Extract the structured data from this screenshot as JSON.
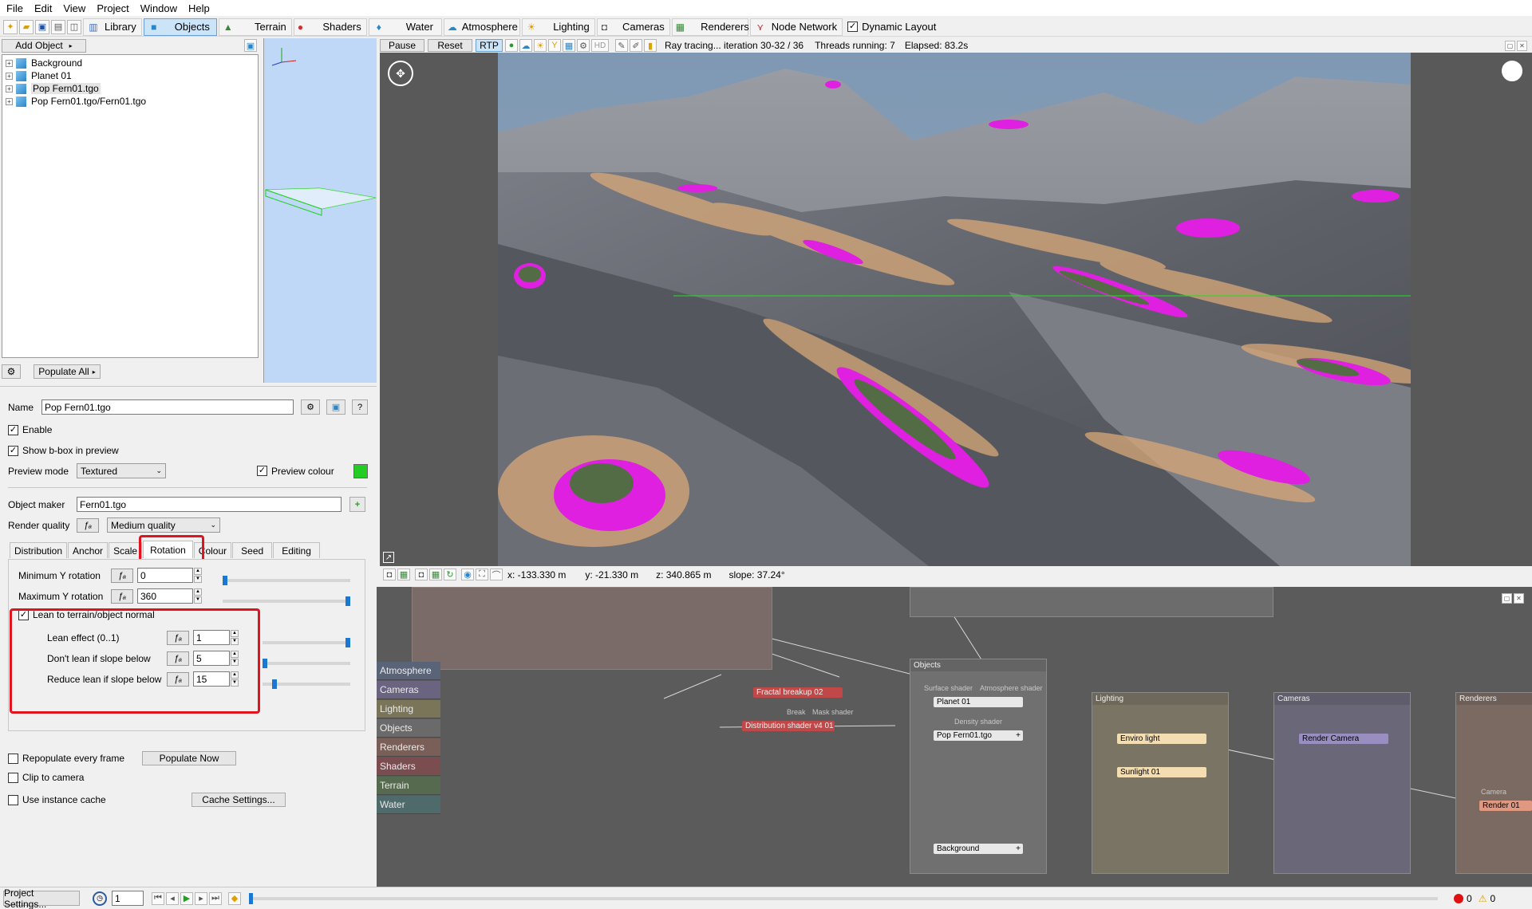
{
  "menu": [
    "File",
    "Edit",
    "View",
    "Project",
    "Window",
    "Help"
  ],
  "toolbar": {
    "tabs": [
      {
        "label": "Library",
        "icon": "library-icon"
      },
      {
        "label": "Objects",
        "icon": "cube-icon",
        "active": true
      },
      {
        "label": "Terrain",
        "icon": "terrain-icon"
      },
      {
        "label": "Shaders",
        "icon": "shader-sphere-icon"
      },
      {
        "label": "Water",
        "icon": "water-drop-icon"
      },
      {
        "label": "Atmosphere",
        "icon": "cloud-icon"
      },
      {
        "label": "Lighting",
        "icon": "sun-icon"
      },
      {
        "label": "Cameras",
        "icon": "camera-icon"
      },
      {
        "label": "Renderers",
        "icon": "render-icon"
      },
      {
        "label": "Node Network",
        "icon": "node-network-icon"
      }
    ],
    "dynamic_layout_label": "Dynamic Layout",
    "dynamic_layout_checked": true
  },
  "object_panel": {
    "add_object_label": "Add Object",
    "tree": [
      "Background",
      "Planet 01",
      "Pop Fern01.tgo",
      "Pop Fern01.tgo/Fern01.tgo"
    ],
    "populate_all_label": "Populate All"
  },
  "props": {
    "name_label": "Name",
    "name_value": "Pop Fern01.tgo",
    "enable_label": "Enable",
    "show_bbox_label": "Show b-box in preview",
    "preview_mode_label": "Preview mode",
    "preview_mode_value": "Textured",
    "preview_colour_label": "Preview colour",
    "preview_colour": "#22cc22",
    "object_maker_label": "Object maker",
    "object_maker_value": "Fern01.tgo",
    "render_quality_label": "Render quality",
    "render_quality_value": "Medium quality",
    "tabs": [
      "Distribution",
      "Anchor",
      "Scale",
      "Rotation",
      "Colour",
      "Seed",
      "Editing"
    ],
    "active_tab": "Rotation",
    "min_y_label": "Minimum Y rotation",
    "min_y_value": "0",
    "max_y_label": "Maximum Y rotation",
    "max_y_value": "360",
    "lean_label": "Lean to terrain/object normal",
    "lean_effect_label": "Lean effect (0..1)",
    "lean_effect_value": "1",
    "dont_lean_label": "Don't lean if slope below",
    "dont_lean_value": "5",
    "reduce_lean_label": "Reduce lean if slope below",
    "reduce_lean_value": "15",
    "repopulate_label": "Repopulate every frame",
    "populate_now_label": "Populate Now",
    "clip_label": "Clip to camera",
    "instance_cache_label": "Use instance cache",
    "cache_settings_label": "Cache Settings...",
    "accent_red": "#e0141e"
  },
  "render_toolbar": {
    "pause_label": "Pause",
    "reset_label": "Reset",
    "rtp_label": "RTP",
    "hd_label": "HD",
    "status": "Ray tracing... iteration 30-32 / 36",
    "threads": "Threads running: 7",
    "elapsed": "Elapsed: 83.2s"
  },
  "view_status": {
    "x": "x: -133.330 m",
    "y": "y: -21.330 m",
    "z": "z: 340.865 m",
    "slope": "slope: 37.24°"
  },
  "node_network": {
    "categories": [
      {
        "label": "Atmosphere",
        "color": "#5a6478"
      },
      {
        "label": "Cameras",
        "color": "#6a6480"
      },
      {
        "label": "Lighting",
        "color": "#7a7458"
      },
      {
        "label": "Objects",
        "color": "#6a6a6a"
      },
      {
        "label": "Renderers",
        "color": "#7a5e58"
      },
      {
        "label": "Shaders",
        "color": "#7a4e50"
      },
      {
        "label": "Terrain",
        "color": "#556a4e"
      },
      {
        "label": "Water",
        "color": "#4e6a6a"
      }
    ],
    "groups": {
      "objects_title": "Objects",
      "lighting_title": "Lighting",
      "cameras_title": "Cameras",
      "renderers_title": "Renderers"
    },
    "nodes": {
      "fractal": "Fractal breakup 02",
      "distribution": "Distribution shader v4 01",
      "planet": "Planet 01",
      "pop_fern": "Pop Fern01.tgo",
      "background": "Background",
      "enviro_light": "Enviro light",
      "sunlight": "Sunlight 01",
      "render_camera": "Render Camera",
      "render": "Render 01"
    },
    "port_labels": {
      "surface": "Surface shader",
      "atmosphere": "Atmosphere shader",
      "density": "Density shader",
      "breakup": "Break",
      "mask": "Mask shader",
      "camera": "Camera"
    }
  },
  "bottombar": {
    "project_settings_label": "Project Settings...",
    "frame_value": "1",
    "errors": "0",
    "warnings": "0"
  }
}
